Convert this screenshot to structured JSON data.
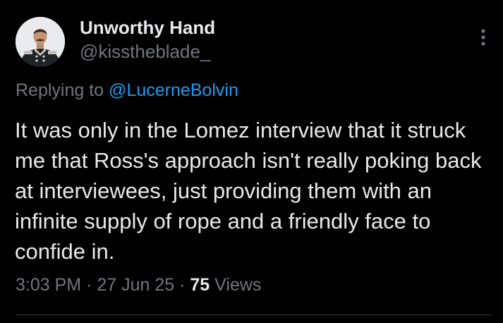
{
  "author": {
    "display_name": "Unworthy Hand",
    "handle": "@kisstheblade_"
  },
  "reply": {
    "prefix": "Replying to ",
    "mention": "@LucerneBolvin"
  },
  "tweet": {
    "text": "It was only in the Lomez interview that it struck me that Ross's approach isn't really poking back at interviewees, just providing them with an infinite supply of rope and a friendly face to confide in."
  },
  "meta": {
    "time": "3:03 PM",
    "separator": "·",
    "date": "27 Jun 25",
    "views_count": "75",
    "views_label": "Views"
  },
  "icons": {
    "more": "more-vertical-icon"
  },
  "colors": {
    "background": "#000000",
    "primary_text": "#e7e9ea",
    "secondary_text": "#71767b",
    "link": "#1d9bf0",
    "divider": "#2f3336"
  }
}
